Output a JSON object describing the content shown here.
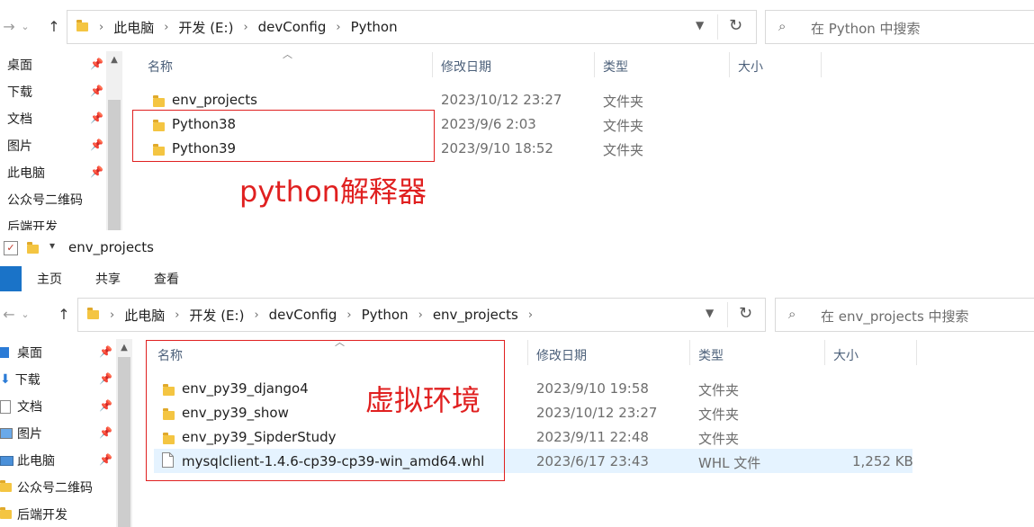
{
  "window1": {
    "nav": {
      "back": "←",
      "forward": "→",
      "up": "↑"
    },
    "address": {
      "crumbs": [
        "此电脑",
        "开发 (E:)",
        "devConfig",
        "Python"
      ]
    },
    "search_placeholder": "在 Python 中搜索",
    "sidebar": [
      "桌面",
      "下载",
      "文档",
      "图片",
      "此电脑",
      "公众号二维码",
      "后端开发"
    ],
    "columns": {
      "name": "名称",
      "date": "修改日期",
      "type": "类型",
      "size": "大小"
    },
    "rows": [
      {
        "name": "env_projects",
        "date": "2023/10/12 23:27",
        "type": "文件夹",
        "size": ""
      },
      {
        "name": "Python38",
        "date": "2023/9/6 2:03",
        "type": "文件夹",
        "size": ""
      },
      {
        "name": "Python39",
        "date": "2023/9/10 18:52",
        "type": "文件夹",
        "size": ""
      }
    ],
    "annotation": "python解释器"
  },
  "window2": {
    "title": "env_projects",
    "ribbon_tabs": [
      "主页",
      "共享",
      "查看"
    ],
    "nav": {
      "back": "←",
      "forward": "→",
      "up": "↑"
    },
    "address": {
      "crumbs": [
        "此电脑",
        "开发 (E:)",
        "devConfig",
        "Python",
        "env_projects"
      ]
    },
    "search_placeholder": "在 env_projects 中搜索",
    "sidebar": [
      "桌面",
      "下载",
      "文档",
      "图片",
      "此电脑",
      "公众号二维码",
      "后端开发"
    ],
    "columns": {
      "name": "名称",
      "date": "修改日期",
      "type": "类型",
      "size": "大小"
    },
    "rows": [
      {
        "name": "env_py39_django4",
        "date": "2023/9/10 19:58",
        "type": "文件夹",
        "size": "",
        "icon": "folder-icon"
      },
      {
        "name": "env_py39_show",
        "date": "2023/10/12 23:27",
        "type": "文件夹",
        "size": "",
        "icon": "folder-icon"
      },
      {
        "name": "env_py39_SipderStudy",
        "date": "2023/9/11 22:48",
        "type": "文件夹",
        "size": "",
        "icon": "folder-icon"
      },
      {
        "name": "mysqlclient-1.4.6-cp39-cp39-win_amd64.whl",
        "date": "2023/6/17 23:43",
        "type": "WHL 文件",
        "size": "1,252 KB",
        "icon": "file-icon"
      }
    ],
    "annotation": "虚拟环境"
  },
  "colors": {
    "annotation": "#e02020",
    "selected_row": "#e5f3ff",
    "folder": "#f4c542",
    "ribbon_file_tab": "#1a73c8"
  }
}
